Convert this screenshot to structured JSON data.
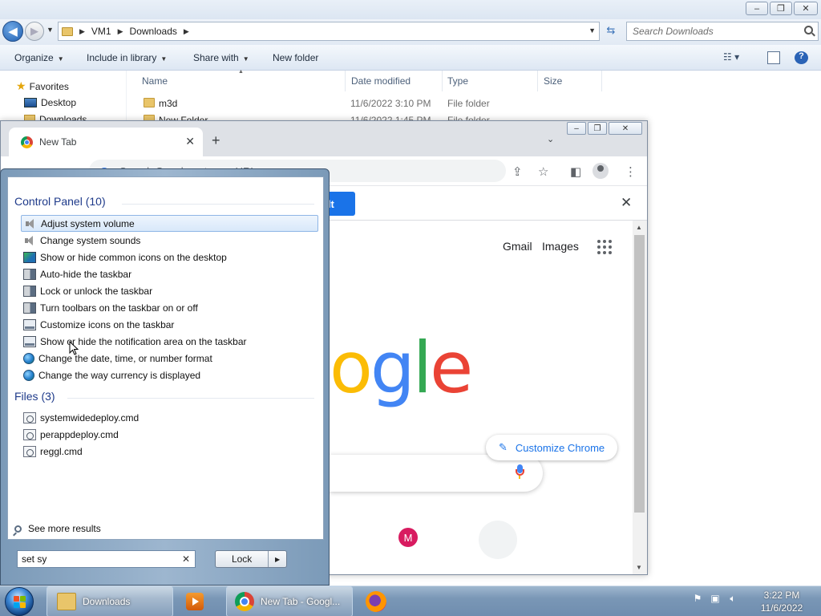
{
  "explorer": {
    "caption": {
      "minimize": "–",
      "maximize": "❐",
      "close": "✕"
    },
    "breadcrumb": [
      "VM1",
      "Downloads"
    ],
    "search_placeholder": "Search Downloads",
    "toolbar": {
      "organize": "Organize",
      "include_in_library": "Include in library",
      "share_with": "Share with",
      "new_folder": "New folder"
    },
    "nav": {
      "favorites": "Favorites",
      "desktop": "Desktop",
      "downloads": "Downloads"
    },
    "columns": {
      "name": "Name",
      "date_modified": "Date modified",
      "type": "Type",
      "size": "Size"
    },
    "files": [
      {
        "name": "m3d",
        "date": "11/6/2022 3:10 PM",
        "type": "File folder"
      },
      {
        "name": "New Folder",
        "date": "11/6/2022 1:45 PM",
        "type": "File folder"
      }
    ]
  },
  "chrome": {
    "tab_title": "New Tab",
    "tab_close": "✕",
    "new_tab": "+",
    "tab_menu": "⌄",
    "omnibox_placeholder": "Search Google or type a URL",
    "infobar_button": "ult",
    "infobar_close": "✕",
    "links": {
      "gmail": "Gmail",
      "images": "Images"
    },
    "logo_partial": [
      "o",
      "g",
      "l",
      "e"
    ],
    "shortcut_letter": "M",
    "customize": "Customize Chrome",
    "colors": {
      "blue": "#4285f4",
      "red": "#ea4335",
      "yellow": "#fbbc05",
      "green": "#34a853",
      "accent": "#1a73e8"
    }
  },
  "start_search": {
    "groups": [
      {
        "title": "Control Panel (10)",
        "items": [
          {
            "label": "Adjust system volume",
            "icon": "speaker-icon",
            "selected": true
          },
          {
            "label": "Change system sounds",
            "icon": "speaker-icon"
          },
          {
            "label": "Show or hide common icons on the desktop",
            "icon": "desktop-icon"
          },
          {
            "label": "Auto-hide the taskbar",
            "icon": "taskbar-icon"
          },
          {
            "label": "Lock or unlock the taskbar",
            "icon": "taskbar-icon"
          },
          {
            "label": "Turn toolbars on the taskbar on or off",
            "icon": "taskbar-icon"
          },
          {
            "label": "Customize icons on the taskbar",
            "icon": "screen-icon"
          },
          {
            "label": "Show or hide the notification area on the taskbar",
            "icon": "screen-icon"
          },
          {
            "label": "Change the date, time, or number format",
            "icon": "globe-icon"
          },
          {
            "label": "Change the way currency is displayed",
            "icon": "globe-icon"
          }
        ]
      },
      {
        "title": "Files (3)",
        "items": [
          {
            "label": "systemwidedeploy.cmd",
            "icon": "cmd-file-icon"
          },
          {
            "label": "perappdeploy.cmd",
            "icon": "cmd-file-icon"
          },
          {
            "label": "reggl.cmd",
            "icon": "cmd-file-icon"
          }
        ]
      }
    ],
    "see_more": "See more results",
    "query": "set sy",
    "clear": "✕",
    "power_button": "Lock",
    "power_arrow": "▶"
  },
  "taskbar": {
    "downloads_label": "Downloads",
    "chrome_label": "New Tab - Googl...",
    "time": "3:22 PM",
    "date": "11/6/2022"
  }
}
